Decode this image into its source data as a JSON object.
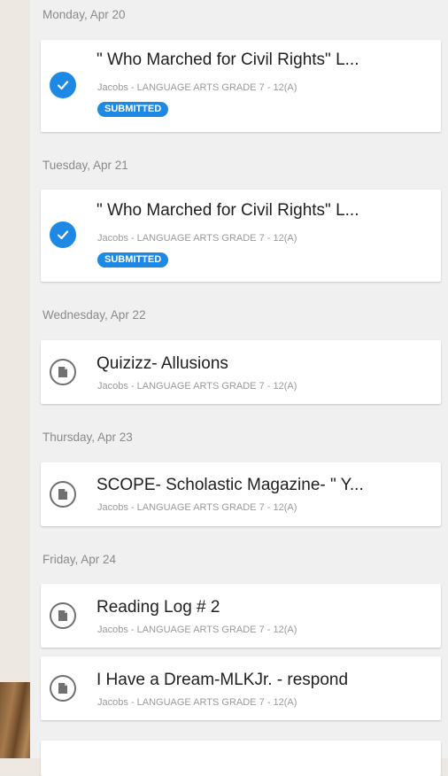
{
  "colors": {
    "accent": "#1e88e5",
    "background": "#f0f0f0",
    "card": "#ffffff"
  },
  "days": [
    {
      "date": "Monday, Apr 20",
      "items": [
        {
          "title": "\" Who Marched for Civil Rights\" L...",
          "course": "Jacobs - LANGUAGE ARTS GRADE 7 - 12(A)",
          "status": "SUBMITTED",
          "icon": "check-circle-icon"
        }
      ]
    },
    {
      "date": "Tuesday, Apr 21",
      "items": [
        {
          "title": "\" Who Marched for Civil Rights\" L...",
          "course": "Jacobs - LANGUAGE ARTS GRADE 7 - 12(A)",
          "status": "SUBMITTED",
          "icon": "check-circle-icon"
        }
      ]
    },
    {
      "date": "Wednesday, Apr 22",
      "items": [
        {
          "title": "Quizizz- Allusions",
          "course": "Jacobs - LANGUAGE ARTS GRADE 7 - 12(A)",
          "icon": "assignment-icon"
        }
      ]
    },
    {
      "date": "Thursday, Apr 23",
      "items": [
        {
          "title": "SCOPE- Scholastic Magazine- \" Y...",
          "course": "Jacobs - LANGUAGE ARTS GRADE 7 - 12(A)",
          "icon": "assignment-icon"
        }
      ]
    },
    {
      "date": "Friday, Apr 24",
      "items": [
        {
          "title": "Reading Log # 2",
          "course": "Jacobs - LANGUAGE ARTS GRADE 7 - 12(A)",
          "icon": "assignment-icon"
        },
        {
          "title": "I Have a Dream-MLKJr. - respond",
          "course": "Jacobs - LANGUAGE ARTS GRADE 7 - 12(A)",
          "icon": "assignment-icon"
        }
      ]
    }
  ]
}
